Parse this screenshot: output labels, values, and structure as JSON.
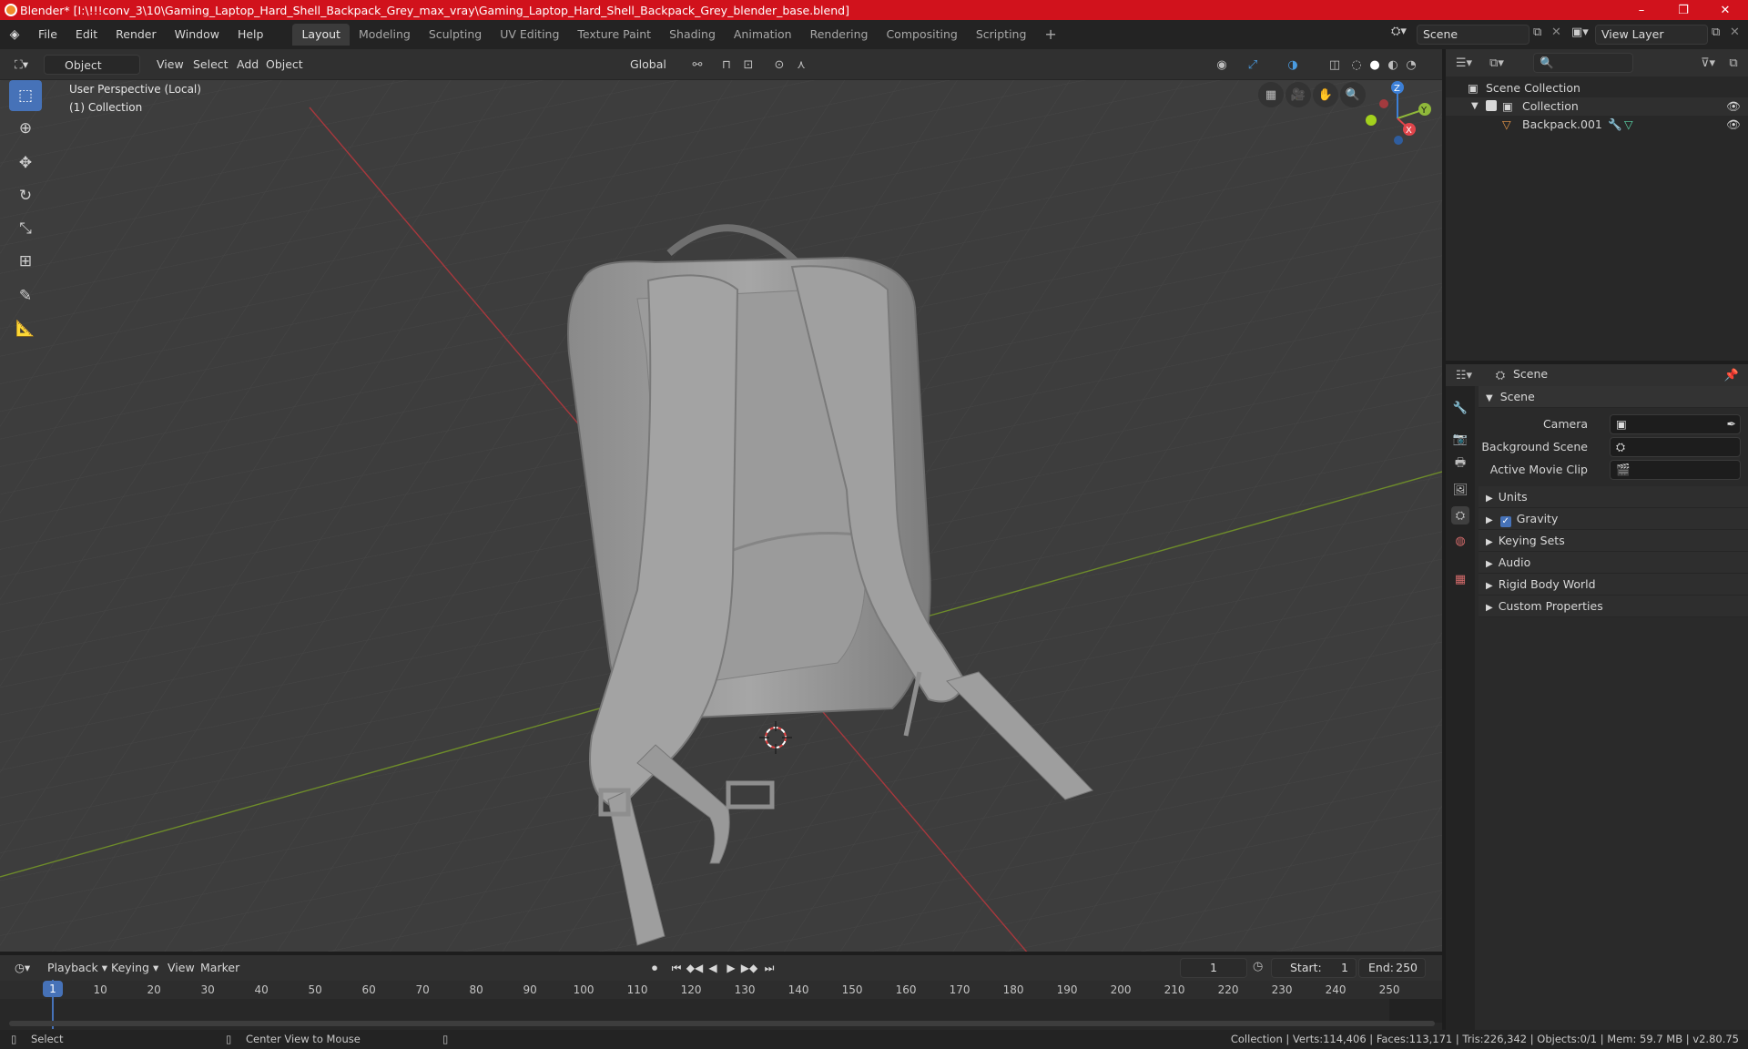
{
  "window": {
    "title": "Blender* [I:\\!!!conv_3\\10\\Gaming_Laptop_Hard_Shell_Backpack_Grey_max_vray\\Gaming_Laptop_Hard_Shell_Backpack_Grey_blender_base.blend]",
    "minimize": "–",
    "maximize": "❐",
    "close": "✕"
  },
  "menus": [
    "File",
    "Edit",
    "Render",
    "Window",
    "Help"
  ],
  "workspaces": [
    "Layout",
    "Modeling",
    "Sculpting",
    "UV Editing",
    "Texture Paint",
    "Shading",
    "Animation",
    "Rendering",
    "Compositing",
    "Scripting"
  ],
  "active_workspace": "Layout",
  "add_workspace": "+",
  "scene_field": "Scene",
  "view_layer_field": "View Layer",
  "viewport": {
    "mode": "Object Mode",
    "menus": [
      "View",
      "Select",
      "Add",
      "Object"
    ],
    "orientation": "Global",
    "perspective": "User Perspective (Local)",
    "collection": "(1) Collection"
  },
  "gizmo": {
    "z": "Z",
    "y": "Y",
    "x": "X"
  },
  "outliner": {
    "search_placeholder": "",
    "scene_collection": "Scene Collection",
    "collection": "Collection",
    "object": "Backpack.001"
  },
  "properties": {
    "context": "Scene",
    "section": "Scene",
    "camera_label": "Camera",
    "background_label": "Background Scene",
    "movie_label": "Active Movie Clip",
    "panels": [
      "Units",
      "Gravity",
      "Keying Sets",
      "Audio",
      "Rigid Body World",
      "Custom Properties"
    ]
  },
  "timeline": {
    "menus": [
      "Playback",
      "Keying",
      "View",
      "Marker"
    ],
    "current_frame": "1",
    "start_label": "Start:",
    "start": "1",
    "end_label": "End:",
    "end": "250",
    "ticks": [
      "1",
      "10",
      "20",
      "30",
      "40",
      "50",
      "60",
      "70",
      "80",
      "90",
      "100",
      "110",
      "120",
      "130",
      "140",
      "150",
      "160",
      "170",
      "180",
      "190",
      "200",
      "210",
      "220",
      "230",
      "240",
      "250"
    ]
  },
  "status": {
    "select": "Select",
    "center": "Center View to Mouse",
    "stats": "Collection | Verts:114,406 | Faces:113,171 | Tris:226,342 | Objects:0/1 | Mem: 59.7 MB | v2.80.75"
  },
  "colors": {
    "title_red": "#d1121c",
    "accent_blue": "#4672b8",
    "x_axis": "#e0454b",
    "y_axis": "#8fb83a",
    "z_axis": "#3c7fd6"
  }
}
